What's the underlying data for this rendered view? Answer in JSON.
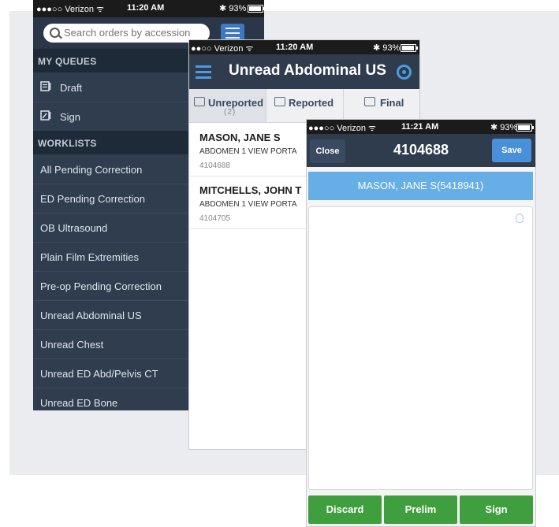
{
  "phone1": {
    "status": {
      "carrier": "●●●○○ Verizon ᯤ",
      "time": "11:20 AM",
      "battery": "✱ 93%",
      "battery_level": 0.93
    },
    "search": {
      "placeholder": "Search orders by accession"
    },
    "queues_header": "MY QUEUES",
    "queues": [
      {
        "label": "Draft",
        "icon": "draft-icon"
      },
      {
        "label": "Sign",
        "icon": "sign-icon"
      }
    ],
    "worklists_header": "WORKLISTS",
    "worklists": [
      "All Pending Correction",
      "ED Pending Correction",
      "OB Ultrasound",
      "Plain Film Extremities",
      "Pre-op Pending Correction",
      "Unread Abdominal US",
      "Unread Chest",
      "Unread ED Abd/Pelvis CT",
      "Unread ED Bone"
    ]
  },
  "phone2": {
    "status": {
      "carrier": "●●○○ Verizon ᯤ",
      "time": "11:20 AM",
      "battery": "✱ 93%",
      "battery_level": 0.93
    },
    "title": "Unread Abdominal US",
    "tabs": [
      {
        "label": "Unreported",
        "count": "(2)",
        "icon": "unreported-tray-icon"
      },
      {
        "label": "Reported",
        "icon": "reported-tray-icon"
      },
      {
        "label": "Final",
        "icon": "final-tray-icon"
      }
    ],
    "orders": [
      {
        "name": "MASON,  JANE S",
        "exam": "ABDOMEN 1 VIEW PORTA",
        "accession": "4104688"
      },
      {
        "name": "MITCHELLS,  JOHN T",
        "exam": "ABDOMEN 1 VIEW PORTA",
        "accession": "4104705"
      }
    ]
  },
  "phone3": {
    "status": {
      "carrier": "●●●○○ Verizon ᯤ",
      "time": "11:21 AM",
      "battery": "✱ 93%",
      "battery_level": 0.93
    },
    "close_label": "Close",
    "title": "4104688",
    "save_label": "Save",
    "patient": "MASON, JANE S(5418941)",
    "actions": {
      "discard": "Discard",
      "prelim": "Prelim",
      "sign": "Sign"
    }
  },
  "colors": {
    "nav_dark": "#2f3d4f",
    "header": "#2e3c4e",
    "accent_blue": "#4a90d8",
    "patient_blue": "#66aee6",
    "action_green": "#3f9e3d"
  }
}
